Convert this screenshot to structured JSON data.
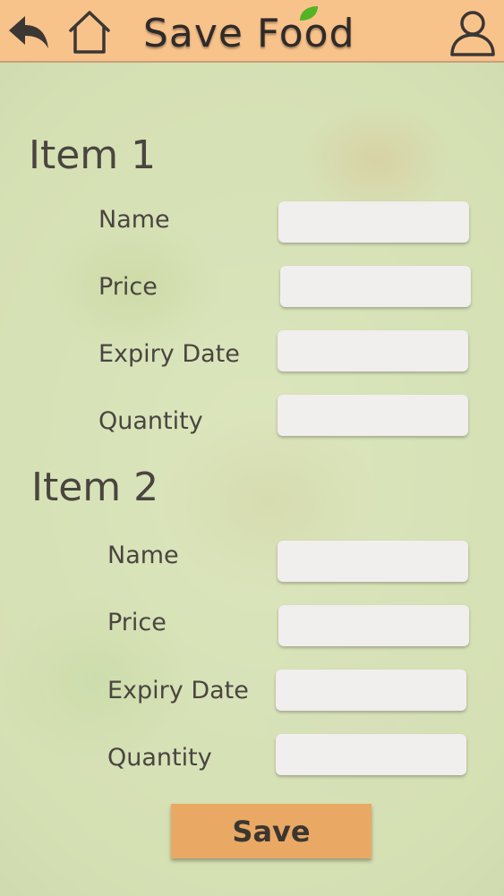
{
  "app": {
    "title": "Save Food"
  },
  "header": {
    "back_icon": "back-arrow-icon",
    "home_icon": "home-icon",
    "profile_icon": "user-profile-icon"
  },
  "items": [
    {
      "title": "Item 1",
      "name_label": "Name",
      "price_label": "Price",
      "expiry_label": "Expiry Date",
      "quantity_label": "Quantity",
      "name_value": "",
      "price_value": "",
      "expiry_value": "",
      "quantity_value": ""
    },
    {
      "title": "Item 2",
      "name_label": "Name",
      "price_label": "Price",
      "expiry_label": "Expiry Date",
      "quantity_label": "Quantity",
      "name_value": "",
      "price_value": "",
      "expiry_value": "",
      "quantity_value": ""
    }
  ],
  "save_label": "Save",
  "colors": {
    "header": "#f8c28b",
    "save_button": "#e9a964",
    "field": "#f1eeee",
    "text": "#4a4540",
    "leaf": "#52b324"
  }
}
